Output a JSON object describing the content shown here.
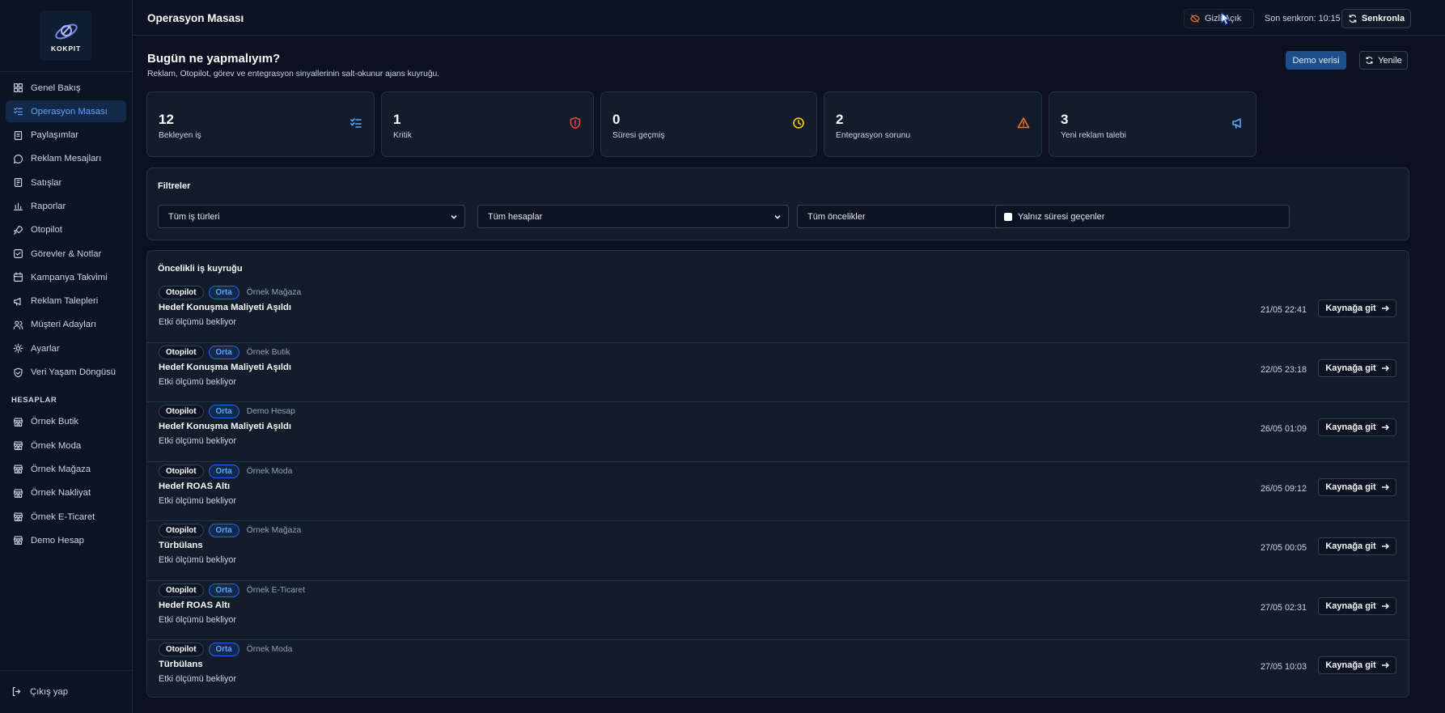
{
  "app": {
    "logo_text": "KOKPIT"
  },
  "sidebar": {
    "items": [
      {
        "label": "Genel Bakış",
        "icon": "grid-icon",
        "active": false
      },
      {
        "label": "Operasyon Masası",
        "icon": "list-check-icon",
        "active": true
      },
      {
        "label": "Paylaşımlar",
        "icon": "share-icon",
        "active": false
      },
      {
        "label": "Reklam Mesajları",
        "icon": "message-icon",
        "active": false
      },
      {
        "label": "Satışlar",
        "icon": "receipt-icon",
        "active": false
      },
      {
        "label": "Raporlar",
        "icon": "bar-chart-icon",
        "active": false
      },
      {
        "label": "Otopilot",
        "icon": "rocket-icon",
        "active": false
      },
      {
        "label": "Görevler & Notlar",
        "icon": "checkbox-icon",
        "active": false
      },
      {
        "label": "Kampanya Takvimi",
        "icon": "calendar-icon",
        "active": false
      },
      {
        "label": "Reklam Talepleri",
        "icon": "megaphone-icon",
        "active": false
      },
      {
        "label": "Müşteri Adayları",
        "icon": "users-icon",
        "active": false
      },
      {
        "label": "Ayarlar",
        "icon": "gear-icon",
        "active": false
      },
      {
        "label": "Veri Yaşam Döngüsü",
        "icon": "shield-icon",
        "active": false
      }
    ],
    "accounts_label": "HESAPLAR",
    "accounts": [
      {
        "label": "Örnek Butik",
        "icon": "store-icon"
      },
      {
        "label": "Örnek Moda",
        "icon": "store-icon"
      },
      {
        "label": "Örnek Mağaza",
        "icon": "store-icon"
      },
      {
        "label": "Örnek Nakliyat",
        "icon": "store-icon"
      },
      {
        "label": "Örnek E-Ticaret",
        "icon": "store-icon"
      },
      {
        "label": "Demo Hesap",
        "icon": "store-icon"
      }
    ],
    "logout_label": "Çıkış yap"
  },
  "topbar": {
    "title": "Operasyon Masası",
    "privacy_label": "Gizli Açık",
    "sync_time": "Son senkron: 10:15",
    "sync_label": "Senkronla"
  },
  "header": {
    "title": "Bugün ne yapmalıyım?",
    "subtitle": "Reklam, Otopilot, görev ve entegrasyon sinyallerinin salt-okunur ajans kuyruğu.",
    "demo_label": "Demo verisi",
    "refresh_label": "Yenile"
  },
  "stats": [
    {
      "value": "12",
      "label": "Bekleyen iş",
      "icon": "list-check-icon",
      "color": "#60a5fa"
    },
    {
      "value": "1",
      "label": "Kritik",
      "icon": "shield-alert-icon",
      "color": "#ef4444"
    },
    {
      "value": "0",
      "label": "Süresi geçmiş",
      "icon": "clock-icon",
      "color": "#facc15"
    },
    {
      "value": "2",
      "label": "Entegrasyon sorunu",
      "icon": "warning-icon",
      "color": "#f97316"
    },
    {
      "value": "3",
      "label": "Yeni reklam talebi",
      "icon": "megaphone-icon",
      "color": "#60a5fa"
    }
  ],
  "filters": {
    "title": "Filtreler",
    "work_type": "Tüm iş türleri",
    "accounts": "Tüm hesaplar",
    "priorities": "Tüm öncelikler",
    "overdue_only": "Yalnız süresi geçenler"
  },
  "queue": {
    "title": "Öncelikli iş kuyruğu",
    "go_label": "Kaynağa git",
    "rows": [
      {
        "type": "Otopilot",
        "priority": "Orta",
        "account": "Örnek Mağaza",
        "title": "Hedef Konuşma Maliyeti Aşıldı",
        "sub": "Etki ölçümü bekliyor",
        "date": "21/05 22:41"
      },
      {
        "type": "Otopilot",
        "priority": "Orta",
        "account": "Örnek Butik",
        "title": "Hedef Konuşma Maliyeti Aşıldı",
        "sub": "Etki ölçümü bekliyor",
        "date": "22/05 23:18"
      },
      {
        "type": "Otopilot",
        "priority": "Orta",
        "account": "Demo Hesap",
        "title": "Hedef Konuşma Maliyeti Aşıldı",
        "sub": "Etki ölçümü bekliyor",
        "date": "26/05 01:09"
      },
      {
        "type": "Otopilot",
        "priority": "Orta",
        "account": "Örnek Moda",
        "title": "Hedef ROAS Altı",
        "sub": "Etki ölçümü bekliyor",
        "date": "26/05 09:12"
      },
      {
        "type": "Otopilot",
        "priority": "Orta",
        "account": "Örnek Mağaza",
        "title": "Türbülans",
        "sub": "Etki ölçümü bekliyor",
        "date": "27/05 00:05"
      },
      {
        "type": "Otopilot",
        "priority": "Orta",
        "account": "Örnek E-Ticaret",
        "title": "Hedef ROAS Altı",
        "sub": "Etki ölçümü bekliyor",
        "date": "27/05 02:31"
      },
      {
        "type": "Otopilot",
        "priority": "Orta",
        "account": "Örnek Moda",
        "title": "Türbülans",
        "sub": "Etki ölçümü bekliyor",
        "date": "27/05 10:03"
      }
    ]
  }
}
